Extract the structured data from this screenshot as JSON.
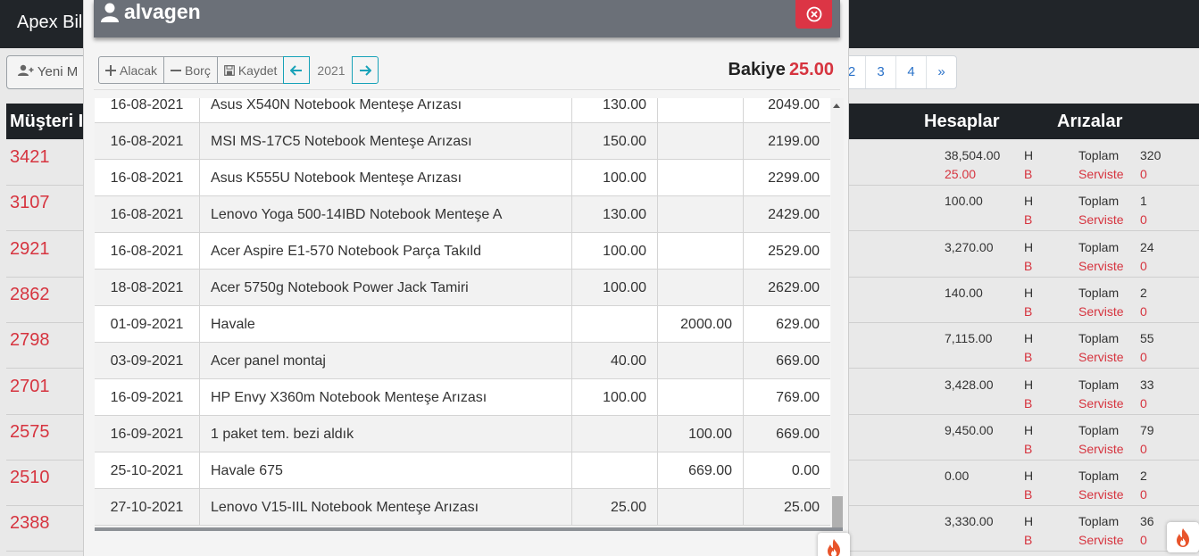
{
  "topnav": {
    "brand": "Apex Bilg"
  },
  "new_button": {
    "label": "Yeni M"
  },
  "pagination": {
    "items": [
      "2",
      "3",
      "4",
      "»"
    ]
  },
  "customers_table": {
    "headers": {
      "customer": "Müşteri I",
      "accounts": "Hesaplar",
      "faults": "Arızalar"
    },
    "rows": [
      {
        "id": "3421",
        "accounts_h": "38,504.00",
        "accounts_b": "25.00",
        "h": "H",
        "b": "B",
        "toplam_label": "Toplam",
        "serviste_label": "Serviste",
        "toplam": "320",
        "serviste": "0"
      },
      {
        "id": "3107",
        "accounts_h": "100.00",
        "accounts_b": "",
        "h": "H",
        "b": "B",
        "toplam_label": "Toplam",
        "serviste_label": "Serviste",
        "toplam": "1",
        "serviste": "0"
      },
      {
        "id": "2921",
        "accounts_h": "3,270.00",
        "accounts_b": "",
        "h": "H",
        "b": "B",
        "toplam_label": "Toplam",
        "serviste_label": "Serviste",
        "toplam": "24",
        "serviste": "0"
      },
      {
        "id": "2862",
        "accounts_h": "140.00",
        "accounts_b": "",
        "h": "H",
        "b": "B",
        "toplam_label": "Toplam",
        "serviste_label": "Serviste",
        "toplam": "2",
        "serviste": "0"
      },
      {
        "id": "2798",
        "accounts_h": "7,115.00",
        "accounts_b": "",
        "h": "H",
        "b": "B",
        "toplam_label": "Toplam",
        "serviste_label": "Serviste",
        "toplam": "55",
        "serviste": "0"
      },
      {
        "id": "2701",
        "accounts_h": "3,428.00",
        "accounts_b": "",
        "h": "H",
        "b": "B",
        "toplam_label": "Toplam",
        "serviste_label": "Serviste",
        "toplam": "33",
        "serviste": "0"
      },
      {
        "id": "2575",
        "accounts_h": "9,450.00",
        "accounts_b": "",
        "h": "H",
        "b": "B",
        "toplam_label": "Toplam",
        "serviste_label": "Serviste",
        "toplam": "79",
        "serviste": "0"
      },
      {
        "id": "2510",
        "accounts_h": "0.00",
        "accounts_b": "",
        "h": "H",
        "b": "B",
        "toplam_label": "Toplam",
        "serviste_label": "Serviste",
        "toplam": "2",
        "serviste": "0"
      },
      {
        "id": "2388",
        "accounts_h": "3,330.00",
        "accounts_b": "",
        "h": "H",
        "b": "B",
        "toplam_label": "Toplam",
        "serviste_label": "Serviste",
        "toplam": "36",
        "serviste": "0"
      }
    ]
  },
  "modal": {
    "title": "alvagen",
    "icons": {
      "user": "user-icon",
      "close": "close-circle-icon"
    },
    "toolbar": {
      "alacak_label": "Alacak",
      "borc_label": "Borç",
      "kaydet_label": "Kaydet",
      "year": "2021"
    },
    "balance": {
      "label": "Bakiye",
      "value": "25.00"
    },
    "ledger": [
      {
        "date": "16-08-2021",
        "desc": "Asus X540N Notebook Menteşe Arızası",
        "alacak": "130.00",
        "borc": "",
        "bakiye": "2049.00"
      },
      {
        "date": "16-08-2021",
        "desc": "MSI MS-17C5 Notebook Menteşe Arızası",
        "alacak": "150.00",
        "borc": "",
        "bakiye": "2199.00"
      },
      {
        "date": "16-08-2021",
        "desc": "Asus K555U Notebook Menteşe Arızası",
        "alacak": "100.00",
        "borc": "",
        "bakiye": "2299.00"
      },
      {
        "date": "16-08-2021",
        "desc": "Lenovo Yoga 500-14IBD Notebook Menteşe A",
        "alacak": "130.00",
        "borc": "",
        "bakiye": "2429.00"
      },
      {
        "date": "16-08-2021",
        "desc": "Acer Aspire E1-570 Notebook Parça Takıld",
        "alacak": "100.00",
        "borc": "",
        "bakiye": "2529.00"
      },
      {
        "date": "18-08-2021",
        "desc": "Acer 5750g Notebook Power Jack Tamiri",
        "alacak": "100.00",
        "borc": "",
        "bakiye": "2629.00"
      },
      {
        "date": "01-09-2021",
        "desc": "Havale",
        "alacak": "",
        "borc": "2000.00",
        "bakiye": "629.00"
      },
      {
        "date": "03-09-2021",
        "desc": "Acer panel montaj",
        "alacak": "40.00",
        "borc": "",
        "bakiye": "669.00"
      },
      {
        "date": "16-09-2021",
        "desc": "HP Envy X360m Notebook Menteşe Arızası",
        "alacak": "100.00",
        "borc": "",
        "bakiye": "769.00"
      },
      {
        "date": "16-09-2021",
        "desc": "1 paket tem. bezi aldık",
        "alacak": "",
        "borc": "100.00",
        "bakiye": "669.00"
      },
      {
        "date": "25-10-2021",
        "desc": "Havale 675",
        "alacak": "",
        "borc": "669.00",
        "bakiye": "0.00"
      },
      {
        "date": "27-10-2021",
        "desc": "Lenovo V15-IIL Notebook Menteşe Arızası",
        "alacak": "25.00",
        "borc": "",
        "bakiye": "25.00"
      }
    ]
  },
  "colors": {
    "accent_red": "#d6343f",
    "nav_dark": "#212529",
    "modal_header": "#6b7078",
    "info": "#17a2b8"
  }
}
